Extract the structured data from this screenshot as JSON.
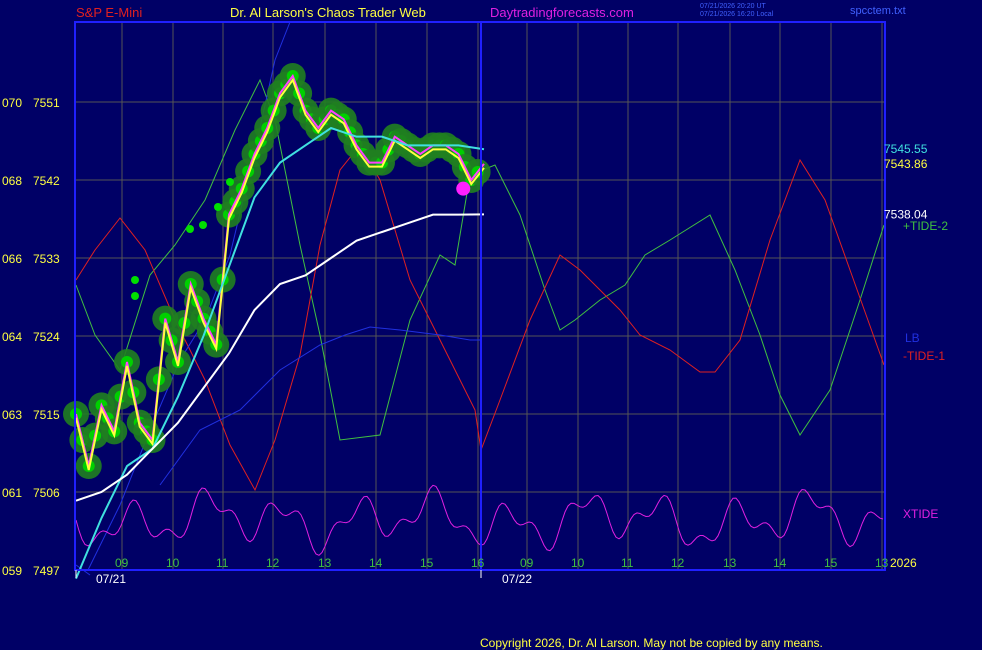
{
  "header": {
    "instrument": "S&P E-Mini",
    "site_title": "Dr. Al Larson's Chaos Trader Web",
    "site_url": "Daytradingforecasts.com",
    "time_utc": "07/21/2026 20:20 UT",
    "time_local": "07/21/2026 16:20 Local",
    "file": "spcctem.txt"
  },
  "footer": {
    "copyright": "Copyright 2026, Dr. Al Larson. May not be copied by any means."
  },
  "colors": {
    "background": "#000066",
    "grid": "#5a5a5a",
    "frame": "#2020ff",
    "price_green": "#00c000",
    "average_yellow": "#ffff40",
    "average_magenta": "#ff40ff",
    "cyan": "#40e0e0",
    "white": "#ffffff",
    "tide2_green": "#40c040",
    "tide1_red": "#e02020",
    "lb_blue": "#2030e0",
    "xtide_magenta": "#e020e0"
  },
  "chart_data": {
    "type": "line",
    "title": "S&P E-Mini",
    "ylim": [
      7497,
      7560
    ],
    "y_ticks": [
      {
        "value": 7497,
        "left": "059",
        "right": "7497"
      },
      {
        "value": 7506,
        "left": "061",
        "right": "7506"
      },
      {
        "value": 7515,
        "left": "063",
        "right": "7515"
      },
      {
        "value": 7524,
        "left": "064",
        "right": "7524"
      },
      {
        "value": 7533,
        "left": "066",
        "right": "7533"
      },
      {
        "value": 7542,
        "left": "068",
        "right": "7542"
      },
      {
        "value": 7551,
        "left": "070",
        "right": "7551"
      }
    ],
    "x_hours": [
      "09",
      "10",
      "11",
      "12",
      "13",
      "14",
      "15",
      "16",
      "09",
      "10",
      "11",
      "12",
      "13",
      "14",
      "15",
      "13"
    ],
    "x_dates": [
      "07/21",
      "07/22"
    ],
    "year_label": "2026",
    "right_labels": [
      {
        "text": "7545.55",
        "color": "#40e0e0",
        "value": 7545.55
      },
      {
        "text": "7543.86",
        "color": "#ffff40",
        "value": 7543.86
      },
      {
        "text": "7538.04",
        "color": "#ffffff",
        "value": 7538.04
      }
    ],
    "legend": [
      {
        "text": "+TIDE-2",
        "color": "#40c040"
      },
      {
        "text": "LB",
        "color": "#2030e0"
      },
      {
        "text": "-TIDE-1",
        "color": "#e02020"
      },
      {
        "text": "XTIDE",
        "color": "#e020e0"
      }
    ],
    "series": [
      {
        "name": "price",
        "x": [
          0,
          0.25,
          0.5,
          0.75,
          1,
          1.25,
          1.5,
          1.75,
          2,
          2.25,
          2.5,
          2.75,
          3,
          3.25,
          3.5,
          3.75,
          4,
          4.25,
          4.5,
          4.75,
          5,
          5.25,
          5.5,
          5.75,
          6,
          6.25,
          6.5,
          6.75,
          7,
          7.25,
          7.5,
          7.75,
          8
        ],
        "values": [
          7515,
          7509,
          7516,
          7513,
          7521,
          7514,
          7512,
          7526,
          7521,
          7530,
          7526,
          7523,
          7538,
          7541,
          7545,
          7548,
          7552,
          7554,
          7550,
          7548,
          7550,
          7549,
          7546,
          7544,
          7544,
          7547,
          7546,
          7545,
          7546,
          7546,
          7545,
          7542,
          7543.86
        ]
      },
      {
        "name": "cyan",
        "x": [
          0,
          0.5,
          1,
          1.5,
          2,
          2.5,
          3,
          3.5,
          4,
          4.5,
          5,
          5.5,
          6,
          6.5,
          7,
          7.5,
          8
        ],
        "values": [
          7496,
          7503,
          7509,
          7511,
          7517,
          7524,
          7532,
          7540,
          7544,
          7546,
          7548,
          7547,
          7547,
          7546,
          7546,
          7546,
          7545.55
        ]
      },
      {
        "name": "white",
        "x": [
          0,
          0.5,
          1,
          1.5,
          2,
          2.5,
          3,
          3.5,
          4,
          4.5,
          5,
          5.5,
          6,
          6.5,
          7,
          7.5,
          8
        ],
        "values": [
          7505,
          7506,
          7508,
          7511,
          7514,
          7518,
          7522,
          7527,
          7530,
          7531,
          7533,
          7535,
          7536,
          7537,
          7538,
          7538,
          7538.04
        ]
      }
    ]
  }
}
